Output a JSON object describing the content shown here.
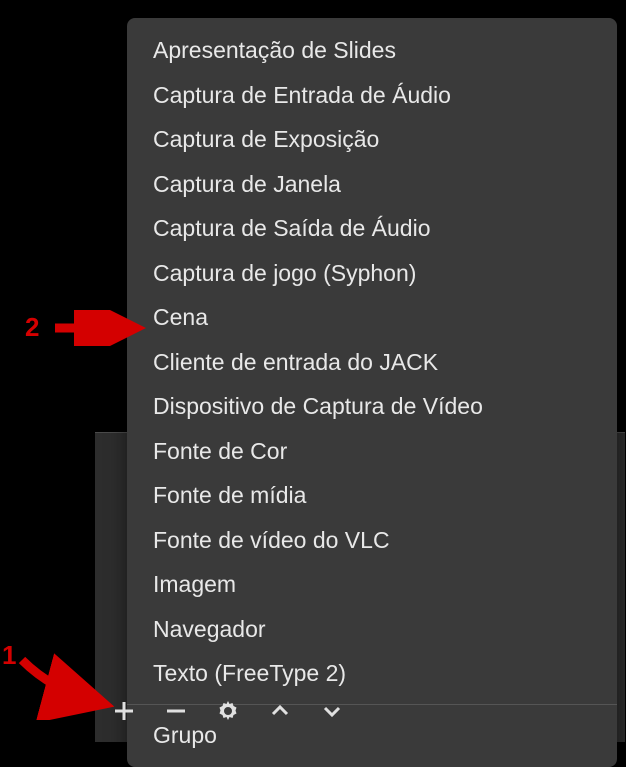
{
  "menu": {
    "items": [
      "Apresentação de Slides",
      "Captura de Entrada de Áudio",
      "Captura de Exposição",
      "Captura de Janela",
      "Captura de Saída de Áudio",
      "Captura de jogo (Syphon)",
      "Cena",
      "Cliente de entrada do JACK",
      "Dispositivo de Captura de Vídeo",
      "Fonte de Cor",
      "Fonte de mídia",
      "Fonte de vídeo do VLC",
      "Imagem",
      "Navegador",
      "Texto (FreeType 2)"
    ],
    "group_label": "Grupo"
  },
  "annotations": {
    "label_1": "1",
    "label_2": "2"
  },
  "colors": {
    "menu_bg": "#3a3a3a",
    "menu_text": "#e8e8e8",
    "annotation": "#d40000",
    "panel_bg": "#2d2d2d"
  }
}
